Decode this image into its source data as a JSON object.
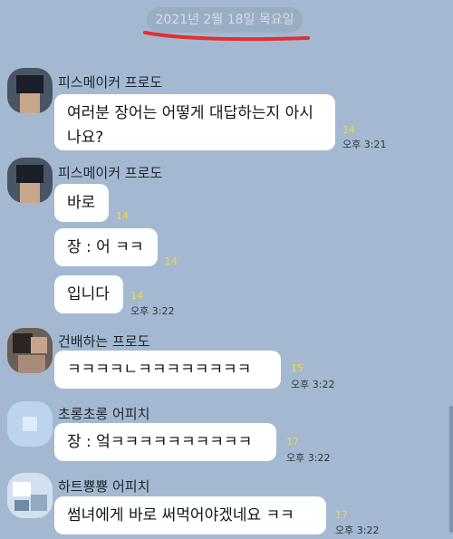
{
  "date_divider": "2021년 2월 18일 목요일",
  "annotation_color": "#e03030",
  "messages": [
    {
      "sender": "피스메이커 프로도",
      "bubbles": [
        {
          "text": "여러분 장어는 어떻게 대답하는지 아시나요?",
          "count": "14",
          "time": "오후 3:21"
        }
      ]
    },
    {
      "sender": "피스메이커 프로도",
      "bubbles": [
        {
          "text": "바로",
          "count": "14"
        },
        {
          "text": "장 : 어 ㅋㅋ",
          "count": "14"
        },
        {
          "text": "입니다",
          "count": "14",
          "time": "오후 3:22"
        }
      ]
    },
    {
      "sender": "건배하는 프로도",
      "bubbles": [
        {
          "text": "ㅋㅋㅋㅋㄴㅋㅋㅋㅋㅋㅋㅋㅋ",
          "count": "15",
          "time": "오후 3:22"
        }
      ]
    },
    {
      "sender": "초롱초롱 어피치",
      "bubbles": [
        {
          "text": "장 : 엌ㅋㅋㅋㅋㅋㅋㅋㅋㅋㅋ",
          "count": "17",
          "time": "오후 3:22"
        }
      ]
    },
    {
      "sender": "하트뿅뿅 어피치",
      "bubbles": [
        {
          "text": "썸녀에게 바로 써먹어야겠네요 ㅋㅋ",
          "count": "17",
          "time": "오후 3:22"
        }
      ]
    }
  ]
}
